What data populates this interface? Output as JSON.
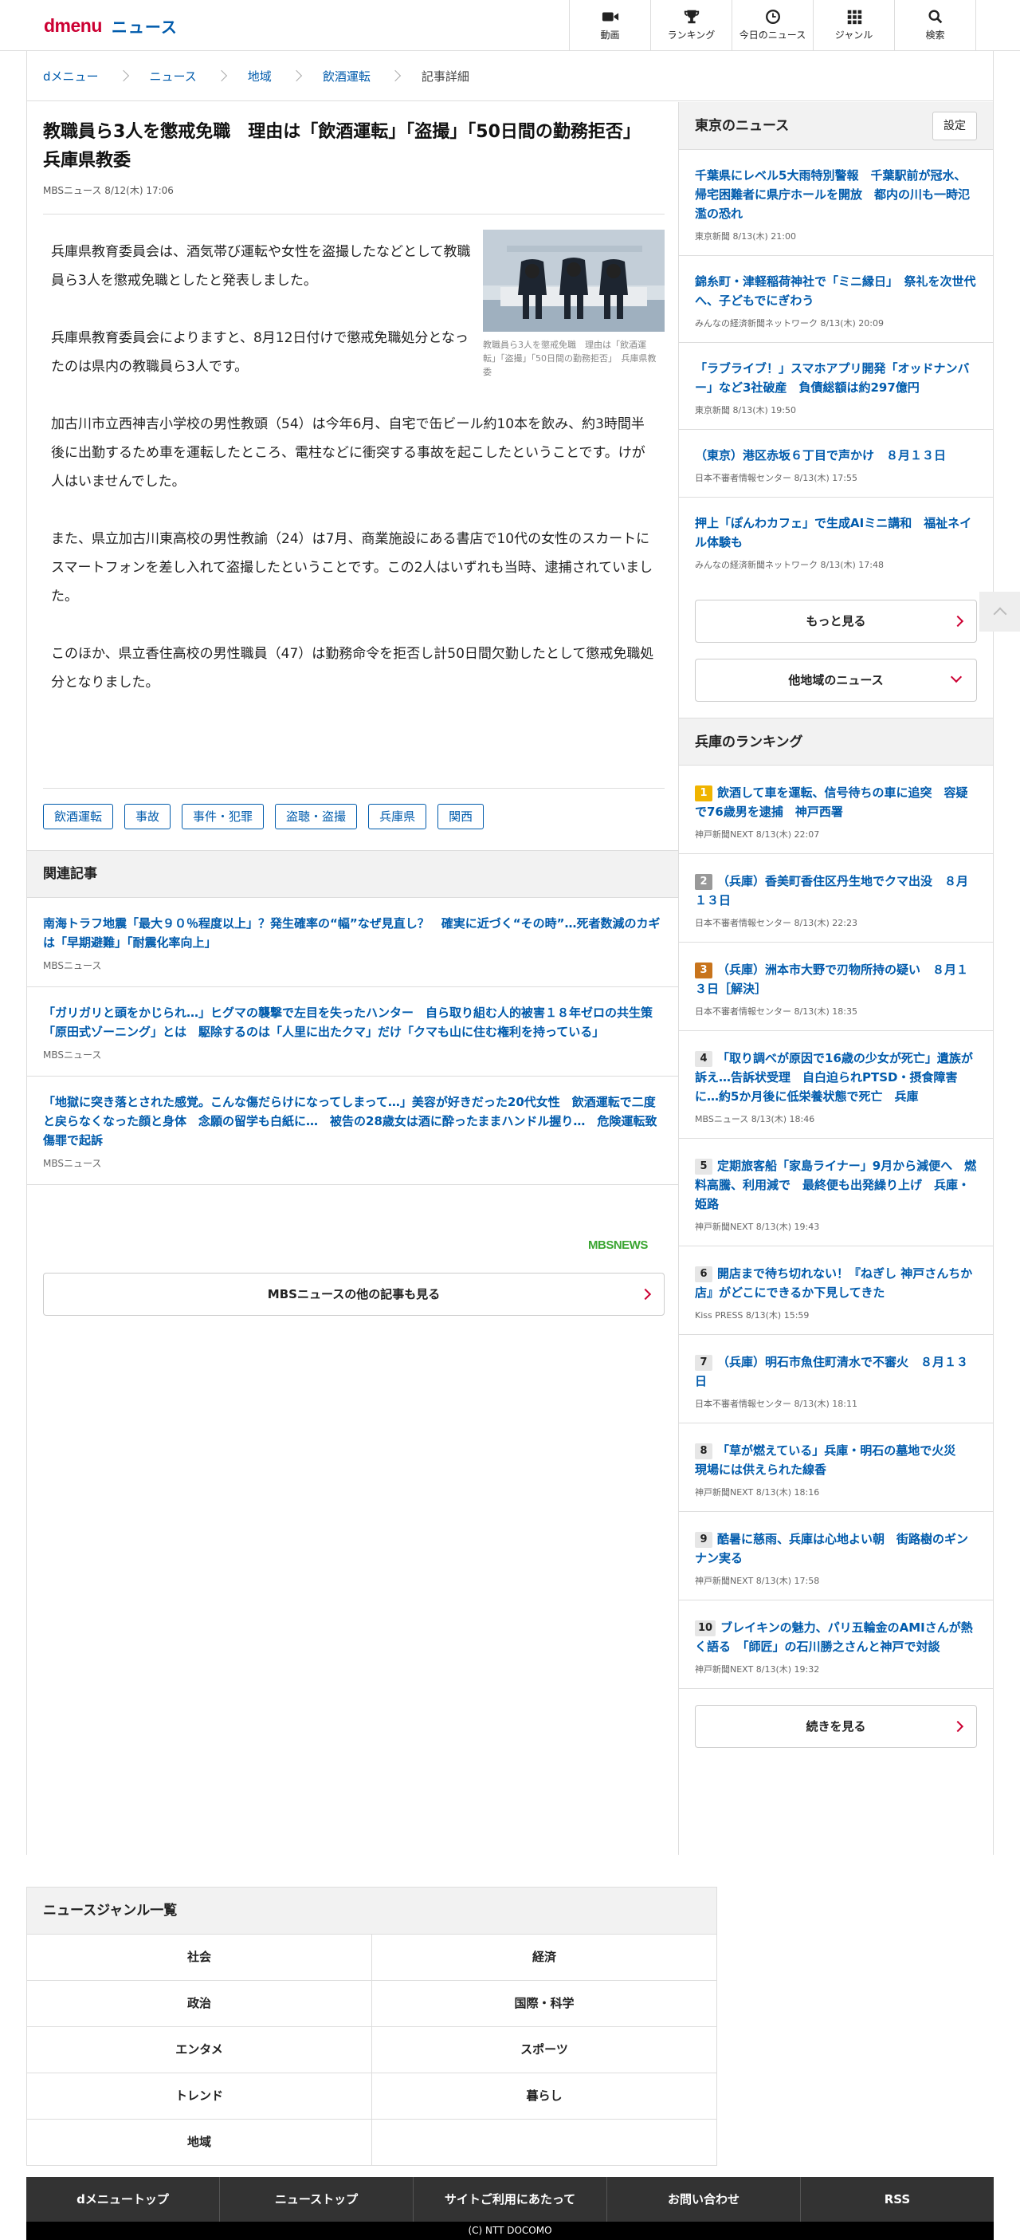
{
  "header": {
    "logo_d": "dmenu",
    "logo_news": "ニュース",
    "nav": [
      {
        "icon": "video-icon",
        "label": "動画"
      },
      {
        "icon": "trophy-icon",
        "label": "ランキング"
      },
      {
        "icon": "clock-icon",
        "label": "今日のニュース"
      },
      {
        "icon": "grid-icon",
        "label": "ジャンル"
      },
      {
        "icon": "search-icon",
        "label": "検索"
      }
    ]
  },
  "breadcrumb": [
    "dメニュー",
    "ニュース",
    "地域",
    "飲酒運転",
    "記事詳細"
  ],
  "article": {
    "title": "教職員ら3人を懲戒免職　理由は「飲酒運転」「盗撮」「50日間の勤務拒否」　兵庫県教委",
    "meta": "MBSニュース  8/12(木) 17:06",
    "photo_caption": "教職員ら3人を懲戒免職　理由は「飲酒運転」「盗撮」「50日間の勤務拒否」　兵庫県教委",
    "paragraphs": [
      "兵庫県教育委員会は、酒気帯び運転や女性を盗撮したなどとして教職員ら3人を懲戒免職としたと発表しました。",
      "兵庫県教育委員会によりますと、8月12日付けで懲戒免職処分となったのは県内の教職員ら3人です。",
      "加古川市立西神吉小学校の男性教頭（54）は今年6月、自宅で缶ビール約10本を飲み、約3時間半後に出勤するため車を運転したところ、電柱などに衝突する事故を起こしたということです。けが人はいませんでした。",
      "また、県立加古川東高校の男性教諭（24）は7月、商業施設にある書店で10代の女性のスカートにスマートフォンを差し入れて盗撮したということです。この2人はいずれも当時、逮捕されていました。",
      "このほか、県立香住高校の男性職員（47）は勤務命令を拒否し計50日間欠勤したとして懲戒免職処分となりました。"
    ],
    "tags": [
      "飲酒運転",
      "事故",
      "事件・犯罪",
      "盗聴・盗撮",
      "兵庫県",
      "関西"
    ]
  },
  "related": {
    "heading": "関連記事",
    "items": [
      {
        "title": "南海トラフ地震「最大９０％程度以上」？発生確率の“幅”なぜ見直し？　確実に近づく“その時”…死者数減のカギは「早期避難」「耐震化率向上」",
        "source": "MBSニュース"
      },
      {
        "title": "「ガリガリと頭をかじられ…」ヒグマの襲撃で左目を失ったハンター　自ら取り組む人的被害１８年ゼロの共生策「原田式ゾーニング」とは　駆除するのは「人里に出たクマ」だけ「クマも山に住む権利を持っている」",
        "source": "MBSニュース"
      },
      {
        "title": "「地獄に突き落とされた感覚。こんな傷だらけになってしまって…」美容が好きだった20代女性　飲酒運転で二度と戻らなくなった顔と身体　念願の留学も白紙に…　被告の28歳女は酒に酔ったままハンドル握り…　危険運転致傷罪で起訴",
        "source": "MBSニュース"
      }
    ],
    "provider_logo": "MBSNEWS",
    "more_label": "MBSニュースの他の記事も見る"
  },
  "tokyo_news": {
    "heading": "東京のニュース",
    "setting_label": "設定",
    "items": [
      {
        "title": "千葉県にレベル5大雨特別警報　千葉駅前が冠水、帰宅困難者に県庁ホールを開放　都内の川も一時氾濫の恐れ",
        "source": "東京新聞  8/13(木) 21:00"
      },
      {
        "title": "錦糸町・津軽稲荷神社で「ミニ縁日」　祭礼を次世代へ、子どもでにぎわう",
        "source": "みんなの経済新聞ネットワーク  8/13(木) 20:09"
      },
      {
        "title": "「ラブライブ！」スマホアプリ開発「オッドナンバー」など3社破産　負債総額は約297億円",
        "source": "東京新聞  8/13(木) 19:50"
      },
      {
        "title": "（東京）港区赤坂６丁目で声かけ　８月１３日",
        "source": "日本不審者情報センター  8/13(木) 17:55"
      },
      {
        "title": "押上「ぽんわカフェ」で生成AIミニ講和　福祉ネイル体験も",
        "source": "みんなの経済新聞ネットワーク  8/13(木) 17:48"
      }
    ],
    "more_label": "もっと見る",
    "other_region_label": "他地域のニュース"
  },
  "ranking": {
    "heading": "兵庫のランキング",
    "items": [
      {
        "rank": "1",
        "title": "飲酒して車を運転、信号待ちの車に追突　容疑で76歳男を逮捕　神戸西署",
        "source": "神戸新聞NEXT  8/13(木) 22:07"
      },
      {
        "rank": "2",
        "title": "（兵庫）香美町香住区丹生地でクマ出没　８月１３日",
        "source": "日本不審者情報センター  8/13(木) 22:23"
      },
      {
        "rank": "3",
        "title": "（兵庫）洲本市大野で刃物所持の疑い　８月１３日［解決］",
        "source": "日本不審者情報センター  8/13(木) 18:35"
      },
      {
        "rank": "4",
        "title": "「取り調べが原因で16歳の少女が死亡」遺族が訴え…告訴状受理　自白迫られPTSD・摂食障害に…約5か月後に低栄養状態で死亡　兵庫",
        "source": "MBSニュース  8/13(木) 18:46"
      },
      {
        "rank": "5",
        "title": "定期旅客船「家島ライナー」9月から減便へ　燃料高騰、利用減で　最終便も出発繰り上げ　兵庫・姫路",
        "source": "神戸新聞NEXT  8/13(木) 19:43"
      },
      {
        "rank": "6",
        "title": "開店まで待ち切れない！『ねぎし 神戸さんちか店』がどこにできるか下見してきた",
        "source": "Kiss PRESS  8/13(木) 15:59"
      },
      {
        "rank": "7",
        "title": "（兵庫）明石市魚住町清水で不審火　８月１３日",
        "source": "日本不審者情報センター  8/13(木) 18:11"
      },
      {
        "rank": "8",
        "title": "「草が燃えている」兵庫・明石の墓地で火災　現場には供えられた線香",
        "source": "神戸新聞NEXT  8/13(木) 18:16"
      },
      {
        "rank": "9",
        "title": "酷暑に慈雨、兵庫は心地よい朝　街路樹のギンナン実る",
        "source": "神戸新聞NEXT  8/13(木) 17:58"
      },
      {
        "rank": "10",
        "title": "ブレイキンの魅力、パリ五輪金のAMIさんが熱く語る　「師匠」の石川勝之さんと神戸で対談",
        "source": "神戸新聞NEXT  8/13(木) 19:32"
      }
    ],
    "more_label": "続きを見る"
  },
  "genre": {
    "heading": "ニュースジャンル一覧",
    "items": [
      "社会",
      "経済",
      "政治",
      "国際・科学",
      "エンタメ",
      "スポーツ",
      "トレンド",
      "暮らし",
      "地域",
      ""
    ]
  },
  "footer": {
    "links": [
      "dメニュートップ",
      "ニューストップ",
      "サイトご利用にあたって",
      "お問い合わせ",
      "RSS"
    ],
    "copyright": "(C) NTT DOCOMO"
  },
  "colors": {
    "link_blue": "#005bac",
    "brand_red": "#cc0033",
    "rank1": "#f0b400",
    "rank2": "#999999",
    "rank3": "#c8741c"
  }
}
